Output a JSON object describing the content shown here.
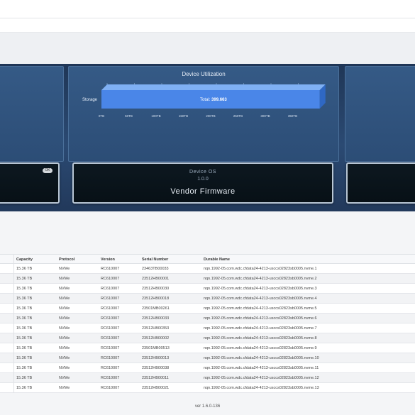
{
  "utilization": {
    "title": "Device Utilization",
    "chart_data": {
      "type": "bar",
      "categories": [
        "Storage"
      ],
      "values": [
        399.663
      ],
      "xlim": [
        0,
        400
      ],
      "x_ticks": [
        "0TB",
        "50TB",
        "100TB",
        "150TB",
        "200TB",
        "250TB",
        "300TB",
        "350TB"
      ],
      "total_label": "Total: ",
      "total_value": "399.663",
      "bar_color": "#4a86e8"
    }
  },
  "device": {
    "os_label": "Device OS",
    "os_version": "1.0.0",
    "name": "Vendor Firmware",
    "badge": "OK"
  },
  "table": {
    "headers": [
      "Capacity",
      "Protocol",
      "Version",
      "Serial Number",
      "Durable Name"
    ],
    "rows": [
      [
        "15.36 TB",
        "NVMe",
        "RC610007",
        "23463TB00033",
        "nqn.1992-05.com.wdc.cfdata24-4213-usccs02823sb0005.nvme.1"
      ],
      [
        "15.36 TB",
        "NVMe",
        "RC610007",
        "23512HB00001",
        "nqn.1992-05.com.wdc.cfdata24-4213-usccs02823sb0005.nvme.2"
      ],
      [
        "15.36 TB",
        "NVMe",
        "RC610007",
        "23512HB00030",
        "nqn.1992-05.com.wdc.cfdata24-4213-usccs02823sb0005.nvme.3"
      ],
      [
        "15.36 TB",
        "NVMe",
        "RC610007",
        "23512HB00018",
        "nqn.1992-05.com.wdc.cfdata24-4213-usccs02823sb0005.nvme.4"
      ],
      [
        "15.36 TB",
        "NVMe",
        "RC610007",
        "23501MB00261",
        "nqn.1992-05.com.wdc.cfdata24-4213-usccs02823sb0005.nvme.5"
      ],
      [
        "15.36 TB",
        "NVMe",
        "RC610007",
        "23512HB00033",
        "nqn.1992-05.com.wdc.cfdata24-4213-usccs02823sb0005.nvme.6"
      ],
      [
        "15.36 TB",
        "NVMe",
        "RC610007",
        "23512HB00353",
        "nqn.1992-05.com.wdc.cfdata24-4213-usccs02823sb0005.nvme.7"
      ],
      [
        "15.36 TB",
        "NVMe",
        "RC610007",
        "23512HB00002",
        "nqn.1992-05.com.wdc.cfdata24-4213-usccs02823sb0005.nvme.8"
      ],
      [
        "15.36 TB",
        "NVMe",
        "RC610007",
        "23501MB00513",
        "nqn.1992-05.com.wdc.cfdata24-4213-usccs02823sb0005.nvme.9"
      ],
      [
        "15.36 TB",
        "NVMe",
        "RC610007",
        "23512HB00013",
        "nqn.1992-05.com.wdc.cfdata24-4213-usccs02823sb0005.nvme.10"
      ],
      [
        "15.36 TB",
        "NVMe",
        "RC610007",
        "23512HB00038",
        "nqn.1992-05.com.wdc.cfdata24-4213-usccs02823sb0005.nvme.11"
      ],
      [
        "15.36 TB",
        "NVMe",
        "RC610007",
        "23512HB00011",
        "nqn.1992-05.com.wdc.cfdata24-4213-usccs02823sb0005.nvme.12"
      ],
      [
        "15.36 TB",
        "NVMe",
        "RC610007",
        "23512HB00021",
        "nqn.1992-05.com.wdc.cfdata24-4213-usccs02823sb0005.nvme.13"
      ]
    ]
  },
  "footer": {
    "version": "ver 1.6.0-136"
  }
}
